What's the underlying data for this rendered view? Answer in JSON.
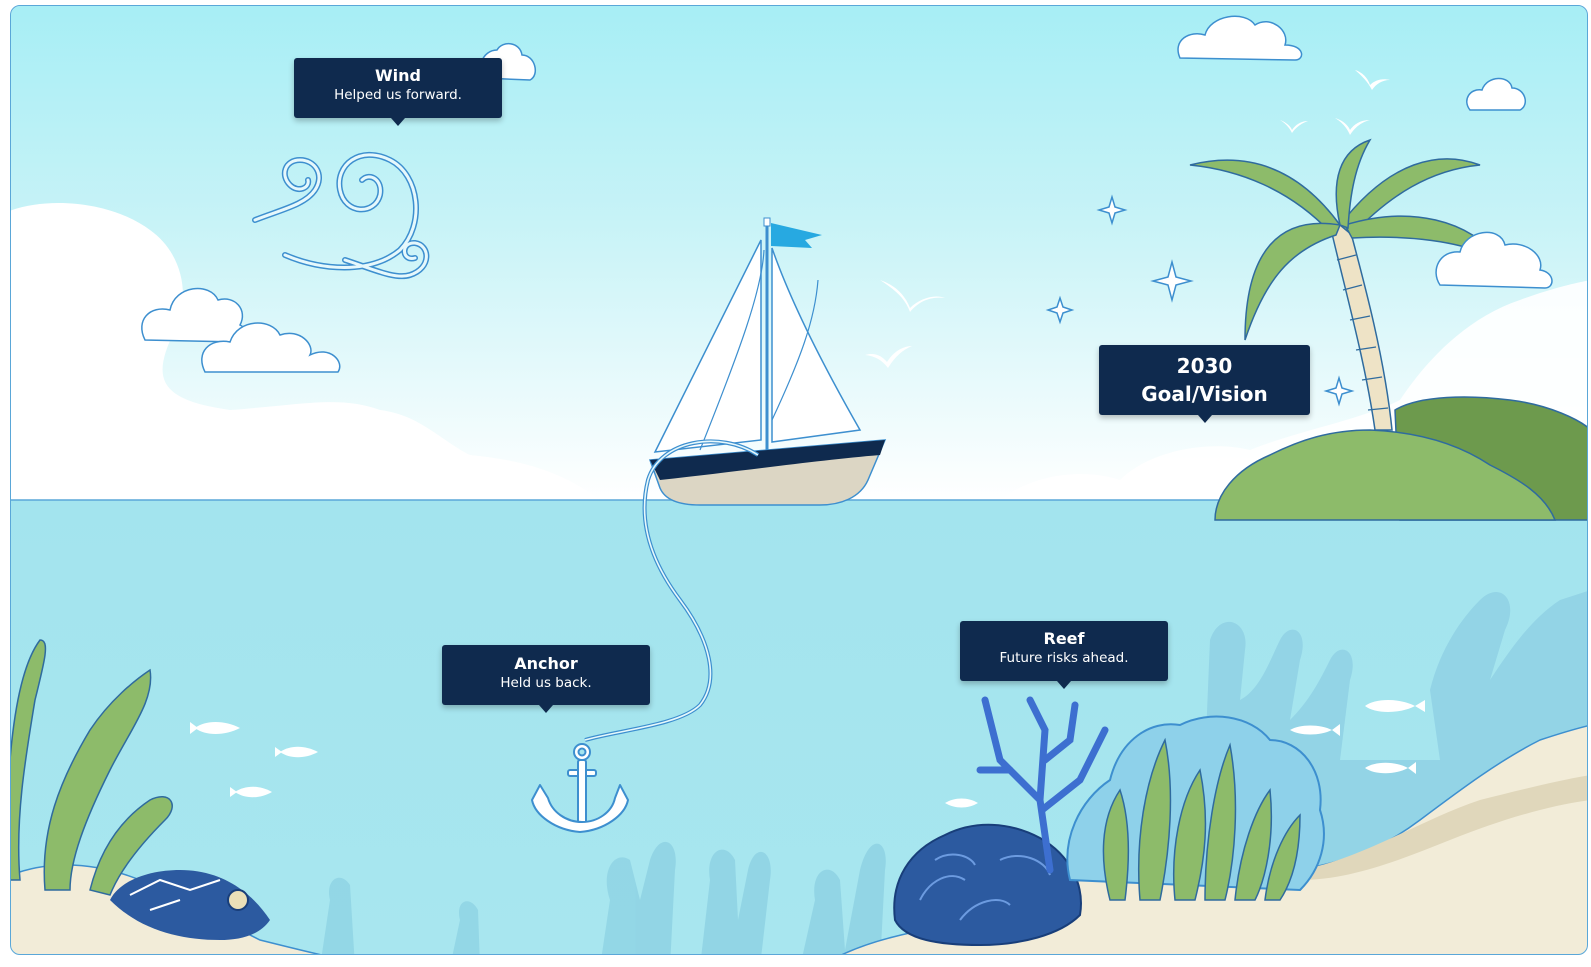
{
  "callouts": {
    "wind": {
      "title": "Wind",
      "subtitle": "Helped us forward."
    },
    "goal": {
      "year": "2030",
      "title": "Goal/Vision"
    },
    "anchor": {
      "title": "Anchor",
      "subtitle": "Held us back."
    },
    "reef": {
      "title": "Reef",
      "subtitle": "Future risks ahead."
    }
  },
  "colors": {
    "sky_top": "#a6eef5",
    "sky_bottom": "#ffffff",
    "sea": "#a3e4ee",
    "label_bg": "#0f2a4e",
    "outline": "#3d8fcf",
    "island_green": "#8dbb6a",
    "sand": "#f2ecd8"
  },
  "icons": [
    "wind-icon",
    "sailboat-icon",
    "flag-icon",
    "anchor-icon",
    "palm-tree-icon",
    "sparkle-icon",
    "seagull-icon",
    "fish-icon",
    "coral-icon",
    "seaweed-icon",
    "cloud-icon"
  ]
}
